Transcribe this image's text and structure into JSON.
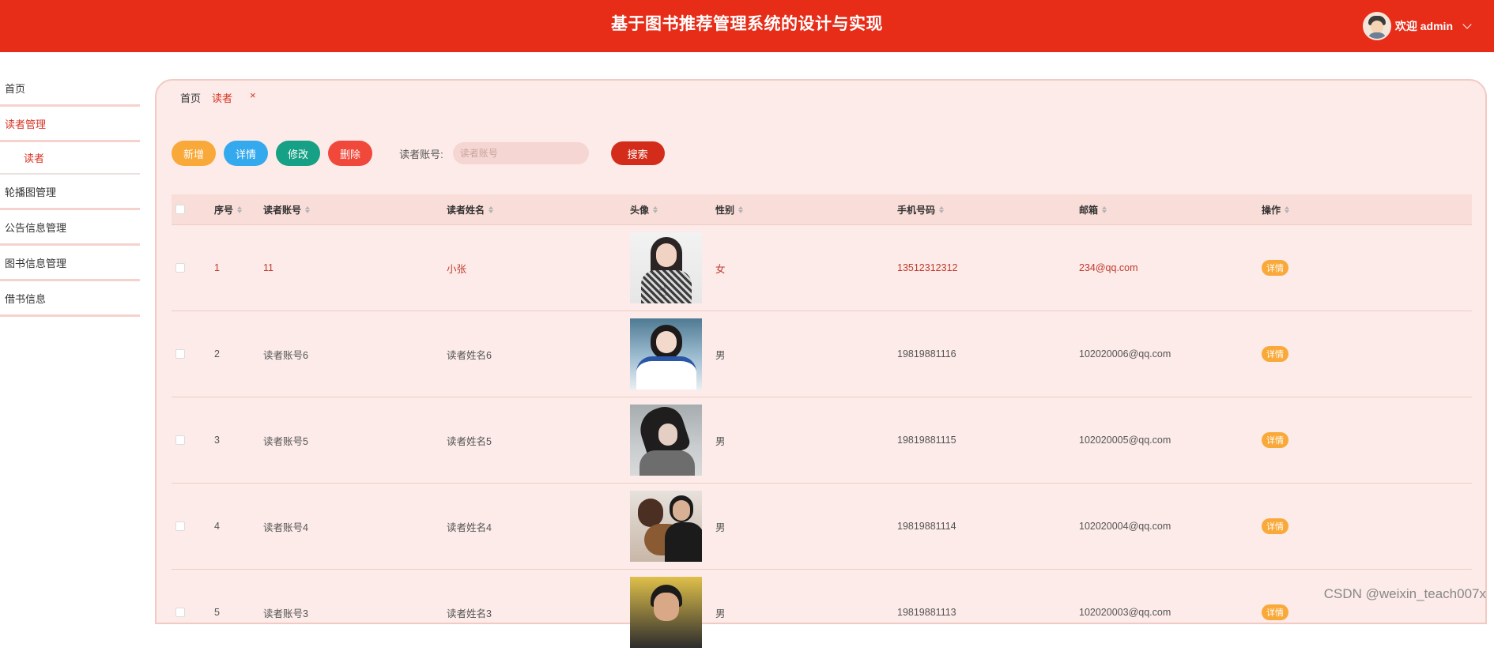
{
  "header": {
    "title": "基于图书推荐管理系统的设计与实现",
    "welcome": "欢迎 admin"
  },
  "sidebar": {
    "items": [
      {
        "label": "首页"
      },
      {
        "label": "读者管理"
      },
      {
        "label": "读者"
      },
      {
        "label": "轮播图管理"
      },
      {
        "label": "公告信息管理"
      },
      {
        "label": "图书信息管理"
      },
      {
        "label": "借书信息"
      }
    ]
  },
  "tabs": [
    {
      "label": "首页"
    },
    {
      "label": "读者",
      "close": "×"
    }
  ],
  "toolbar": {
    "add": "新增",
    "detail": "详情",
    "edit": "修改",
    "delete": "删除",
    "search_label": "读者账号:",
    "search_placeholder": "读者账号",
    "search_button": "搜索"
  },
  "table": {
    "headers": {
      "index": "序号",
      "account": "读者账号",
      "name": "读者姓名",
      "avatar": "头像",
      "gender": "性别",
      "phone": "手机号码",
      "email": "邮箱",
      "action": "操作"
    },
    "rows": [
      {
        "index": "1",
        "account": "11",
        "name": "小张",
        "gender": "女",
        "phone": "13512312312",
        "email": "234@qq.com",
        "action": "详情"
      },
      {
        "index": "2",
        "account": "读者账号6",
        "name": "读者姓名6",
        "gender": "男",
        "phone": "19819881116",
        "email": "102020006@qq.com",
        "action": "详情"
      },
      {
        "index": "3",
        "account": "读者账号5",
        "name": "读者姓名5",
        "gender": "男",
        "phone": "19819881115",
        "email": "102020005@qq.com",
        "action": "详情"
      },
      {
        "index": "4",
        "account": "读者账号4",
        "name": "读者姓名4",
        "gender": "男",
        "phone": "19819881114",
        "email": "102020004@qq.com",
        "action": "详情"
      },
      {
        "index": "5",
        "account": "读者账号3",
        "name": "读者姓名3",
        "gender": "男",
        "phone": "19819881113",
        "email": "102020003@qq.com",
        "action": "详情"
      }
    ]
  },
  "watermark": "CSDN @weixin_teach007x",
  "colors": {
    "header": "#e72c18",
    "accent": "#d73526",
    "panel": "#fcebe8",
    "add": "#f9a93a",
    "detail": "#35a9ee",
    "edit": "#16a085",
    "delete": "#f0483a"
  }
}
